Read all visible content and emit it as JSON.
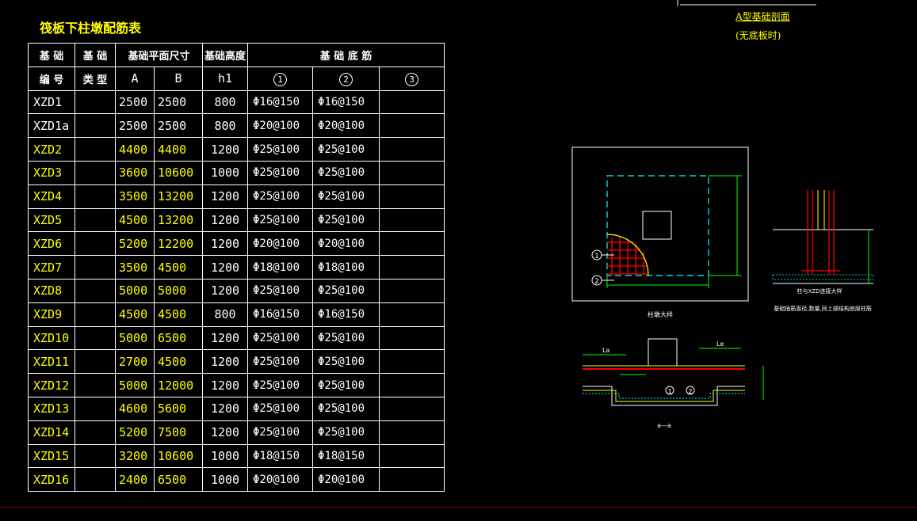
{
  "title": "筏板下柱墩配筋表",
  "table": {
    "header_row1": {
      "code": "基 础",
      "type": "基 础",
      "plan_size": "基础平面尺寸",
      "height": "基础高度",
      "bottom_rebar": "基 础 底 筋"
    },
    "header_row2": {
      "code": "编 号",
      "type": "类 型",
      "a": "A",
      "b": "B",
      "h1": "h1",
      "r1": "1",
      "r2": "2",
      "r3": "3"
    },
    "rows": [
      {
        "code": "XZD1",
        "type": "",
        "a": "2500",
        "b": "2500",
        "h1": "800",
        "r1": "Φ16@150",
        "r2": "Φ16@150",
        "r3": "",
        "hl": false
      },
      {
        "code": "XZD1a",
        "type": "",
        "a": "2500",
        "b": "2500",
        "h1": "800",
        "r1": "Φ20@100",
        "r2": "Φ20@100",
        "r3": "",
        "hl": false
      },
      {
        "code": "XZD2",
        "type": "",
        "a": "4400",
        "b": "4400",
        "h1": "1200",
        "r1": "Φ25@100",
        "r2": "Φ25@100",
        "r3": "",
        "hl": true
      },
      {
        "code": "XZD3",
        "type": "",
        "a": "3600",
        "b": "10600",
        "h1": "1000",
        "r1": "Φ25@100",
        "r2": "Φ25@100",
        "r3": "",
        "hl": true
      },
      {
        "code": "XZD4",
        "type": "",
        "a": "3500",
        "b": "13200",
        "h1": "1200",
        "r1": "Φ25@100",
        "r2": "Φ25@100",
        "r3": "",
        "hl": true
      },
      {
        "code": "XZD5",
        "type": "",
        "a": "4500",
        "b": "13200",
        "h1": "1200",
        "r1": "Φ25@100",
        "r2": "Φ25@100",
        "r3": "",
        "hl": true
      },
      {
        "code": "XZD6",
        "type": "",
        "a": "5200",
        "b": "12200",
        "h1": "1200",
        "r1": "Φ20@100",
        "r2": "Φ20@100",
        "r3": "",
        "hl": true
      },
      {
        "code": "XZD7",
        "type": "",
        "a": "3500",
        "b": "4500",
        "h1": "1200",
        "r1": "Φ18@100",
        "r2": "Φ18@100",
        "r3": "",
        "hl": true
      },
      {
        "code": "XZD8",
        "type": "",
        "a": "5000",
        "b": "5000",
        "h1": "1200",
        "r1": "Φ25@100",
        "r2": "Φ25@100",
        "r3": "",
        "hl": true
      },
      {
        "code": "XZD9",
        "type": "",
        "a": "4500",
        "b": "4500",
        "h1": "800",
        "r1": "Φ16@150",
        "r2": "Φ16@150",
        "r3": "",
        "hl": true
      },
      {
        "code": "XZD10",
        "type": "",
        "a": "5000",
        "b": "6500",
        "h1": "1200",
        "r1": "Φ25@100",
        "r2": "Φ25@100",
        "r3": "",
        "hl": true
      },
      {
        "code": "XZD11",
        "type": "",
        "a": "2700",
        "b": "4500",
        "h1": "1200",
        "r1": "Φ25@100",
        "r2": "Φ25@100",
        "r3": "",
        "hl": true
      },
      {
        "code": "XZD12",
        "type": "",
        "a": "5000",
        "b": "12000",
        "h1": "1200",
        "r1": "Φ25@100",
        "r2": "Φ25@100",
        "r3": "",
        "hl": true
      },
      {
        "code": "XZD13",
        "type": "",
        "a": "4600",
        "b": "5600",
        "h1": "1200",
        "r1": "Φ25@100",
        "r2": "Φ25@100",
        "r3": "",
        "hl": true
      },
      {
        "code": "XZD14",
        "type": "",
        "a": "5200",
        "b": "7500",
        "h1": "1200",
        "r1": "Φ25@100",
        "r2": "Φ25@100",
        "r3": "",
        "hl": true
      },
      {
        "code": "XZD15",
        "type": "",
        "a": "3200",
        "b": "10600",
        "h1": "1000",
        "r1": "Φ18@150",
        "r2": "Φ18@150",
        "r3": "",
        "hl": true
      },
      {
        "code": "XZD16",
        "type": "",
        "a": "2400",
        "b": "6500",
        "h1": "1000",
        "r1": "Φ20@100",
        "r2": "Φ20@100",
        "r3": "",
        "hl": true
      }
    ]
  },
  "detail_a": {
    "label1": "A型基础剖面",
    "label2": "(无底板时)"
  },
  "plan_detail": {
    "caption": "柱墩大样",
    "mark1": "1",
    "mark2": "2"
  },
  "section_detail": {
    "caption1": "柱与XZD连接大样",
    "caption2": "基础插筋直径,数量,同上部结构底层柱筋"
  },
  "bottom_detail": {
    "caption": "a—a",
    "mark1": "1",
    "mark2": "2",
    "la": "La",
    "le": "Le"
  },
  "colors": {
    "yellow": "#ffff00",
    "white": "#ffffff",
    "cyan": "#00ffff",
    "red": "#ff0000",
    "green": "#00ff00"
  }
}
